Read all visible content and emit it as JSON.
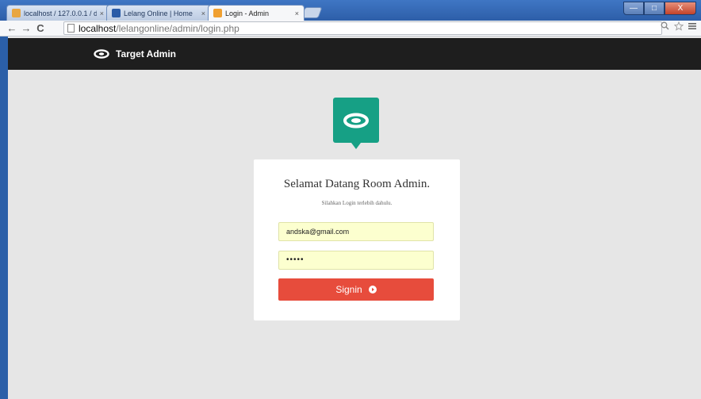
{
  "browser": {
    "tabs": [
      {
        "title": "localhost / 127.0.0.1 / db_",
        "close": "×",
        "favicon_color": "#e9a640",
        "active": false
      },
      {
        "title": "Lelang Online | Home",
        "close": "×",
        "favicon_color": "#2a5ba7",
        "active": false
      },
      {
        "title": "Login - Admin",
        "close": "×",
        "favicon_color": "#f0a030",
        "active": true
      }
    ],
    "window_controls": {
      "minimize": "—",
      "maximize": "□",
      "close": "X"
    },
    "nav": {
      "back": "←",
      "forward": "→",
      "reload": "C"
    },
    "address": {
      "host": "localhost",
      "path": "/lelangonline/admin/login.php"
    },
    "toolbar_icons": [
      "zoom-icon",
      "star-icon",
      "menu-icon"
    ]
  },
  "site": {
    "brand": "Target Admin",
    "accent_color": "#16a085"
  },
  "login": {
    "title": "Selamat Datang Room Admin.",
    "subtitle": "Silahkan Login terlebih dahulu.",
    "email_value": "andska@gmail.com",
    "password_mask": "•••••",
    "signin_label": "Signin",
    "button_color": "#e74c3c"
  }
}
